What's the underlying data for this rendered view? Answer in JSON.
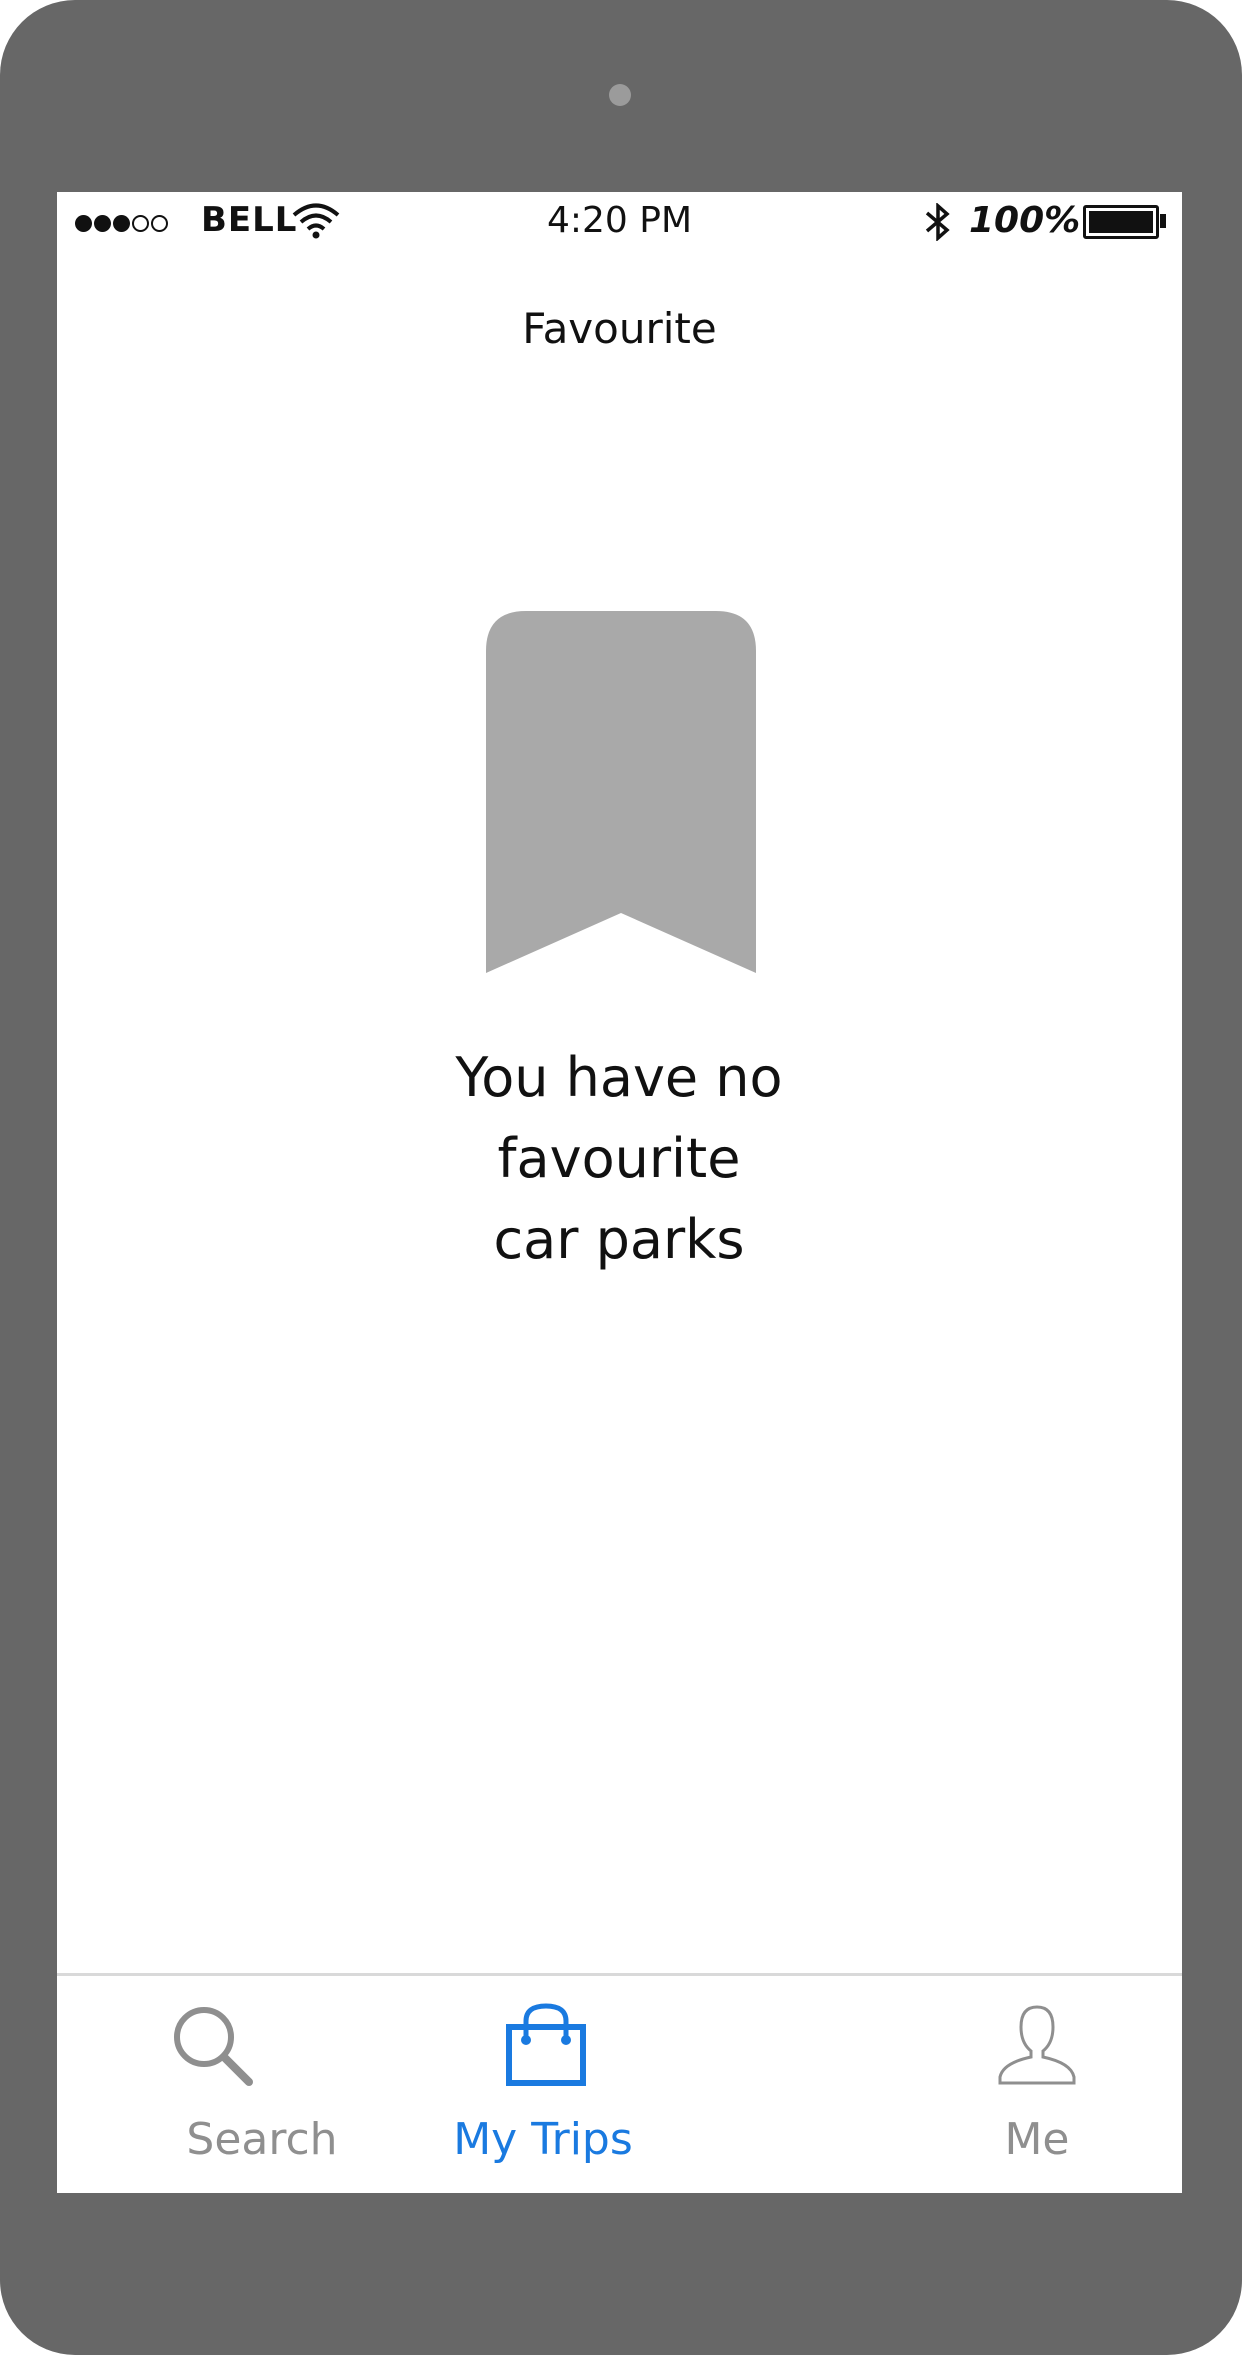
{
  "status_bar": {
    "signal_filled": 3,
    "signal_total": 5,
    "carrier": "BELL",
    "time": "4:20 PM",
    "battery_percent": "100%"
  },
  "header": {
    "title": "Favourite"
  },
  "empty_state": {
    "icon": "bookmark-icon",
    "message_lines": [
      "You have no",
      "favourite",
      "car parks"
    ]
  },
  "tab_bar": {
    "active_tab": "My Trips",
    "tabs": [
      {
        "label": "Search",
        "icon": "search-icon",
        "active": false
      },
      {
        "label": "My Trips",
        "icon": "shopping-bag-icon",
        "active": true
      },
      {
        "label": "Me",
        "icon": "user-icon",
        "active": false
      }
    ]
  },
  "colors": {
    "device_frame": "#676767",
    "accent": "#1a7ae0",
    "inactive": "#8f8f8f",
    "placeholder_icon": "#a9a9a9"
  }
}
